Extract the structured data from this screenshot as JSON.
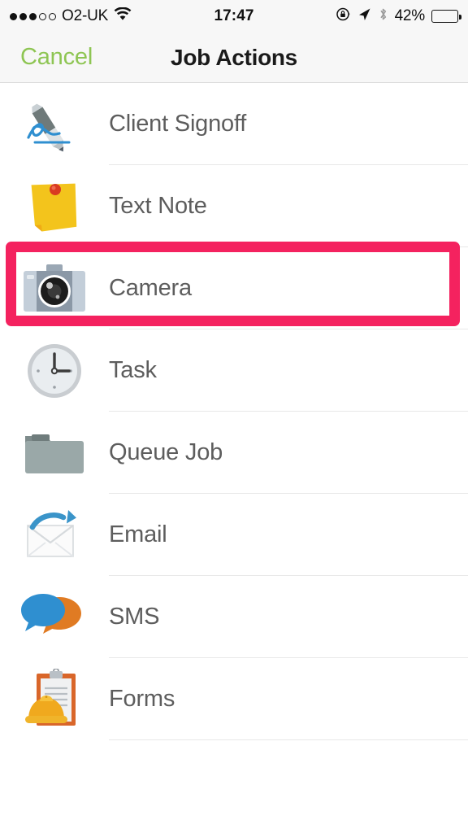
{
  "status_bar": {
    "signal_dots_filled": 3,
    "signal_dots_total": 5,
    "carrier": "O2-UK",
    "wifi_icon": "wifi-icon",
    "time": "17:47",
    "rotation_lock_icon": "rotation-lock-icon",
    "location_icon": "location-arrow-icon",
    "bluetooth_icon": "bluetooth-icon",
    "battery_percent": "42%",
    "battery_level": 42
  },
  "nav_bar": {
    "cancel_label": "Cancel",
    "title": "Job Actions",
    "cancel_color": "#8ec553"
  },
  "annotation": {
    "type": "highlight-rectangle",
    "color": "#f4225f",
    "target": "Camera"
  },
  "list": {
    "items": [
      {
        "label": "Client Signoff",
        "icon": "pen-signature-icon",
        "highlighted": false
      },
      {
        "label": "Text Note",
        "icon": "sticky-note-icon",
        "highlighted": false
      },
      {
        "label": "Camera",
        "icon": "camera-icon",
        "highlighted": true
      },
      {
        "label": "Task",
        "icon": "clock-icon",
        "highlighted": false
      },
      {
        "label": "Queue Job",
        "icon": "folder-icon",
        "highlighted": false
      },
      {
        "label": "Email",
        "icon": "envelope-send-icon",
        "highlighted": false
      },
      {
        "label": "SMS",
        "icon": "speech-bubbles-icon",
        "highlighted": false
      },
      {
        "label": "Forms",
        "icon": "clipboard-hardhat-icon",
        "highlighted": false
      }
    ]
  }
}
